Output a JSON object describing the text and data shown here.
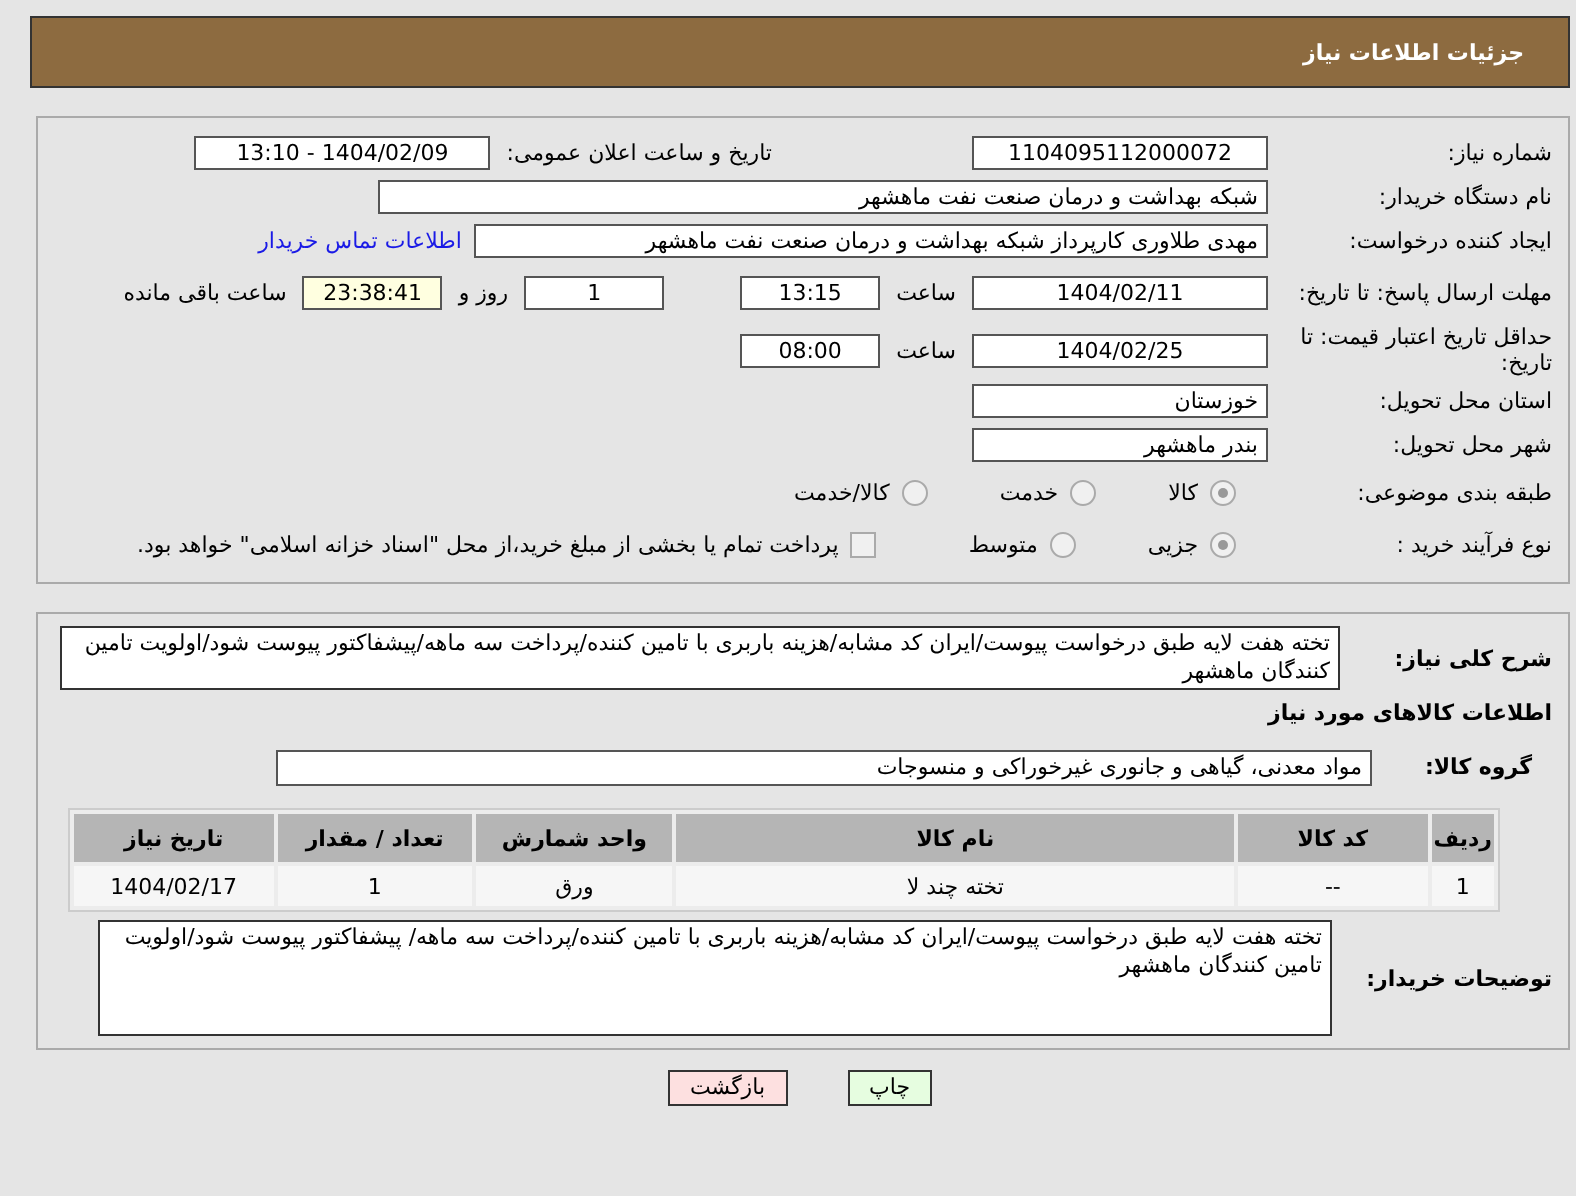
{
  "header": {
    "title": "جزئیات اطلاعات نیاز"
  },
  "need_number": {
    "label": "شماره نیاز:",
    "value": "1104095112000072"
  },
  "announce_datetime": {
    "label": "تاریخ و ساعت اعلان عمومی:",
    "value": "1404/02/09 - 13:10"
  },
  "buyer_org": {
    "label": "نام دستگاه خریدار:",
    "value": "شبکه بهداشت و درمان صنعت نفت ماهشهر"
  },
  "requester": {
    "label": "ایجاد کننده درخواست:",
    "value": "مهدی طلاوری کارپرداز شبکه بهداشت و درمان صنعت نفت ماهشهر",
    "link": "اطلاعات تماس خریدار"
  },
  "response_deadline": {
    "label": "مهلت ارسال پاسخ: تا تاریخ:",
    "date": "1404/02/11",
    "time_label": "ساعت",
    "time": "13:15",
    "days": "1",
    "days_label": "روز و",
    "remaining": "23:38:41",
    "remaining_label": "ساعت باقی مانده"
  },
  "price_validity": {
    "label": "حداقل تاریخ اعتبار قیمت: تا تاریخ:",
    "date": "1404/02/25",
    "time_label": "ساعت",
    "time": "08:00"
  },
  "delivery_province": {
    "label": "استان محل تحویل:",
    "value": "خوزستان"
  },
  "delivery_city": {
    "label": "شهر محل تحویل:",
    "value": "بندر ماهشهر"
  },
  "category": {
    "label": "طبقه بندی موضوعی:",
    "options": [
      {
        "label": "کالا",
        "selected": true
      },
      {
        "label": "خدمت",
        "selected": false
      },
      {
        "label": "کالا/خدمت",
        "selected": false
      }
    ]
  },
  "purchase_process": {
    "label": "نوع فرآیند خرید :",
    "options": [
      {
        "label": "جزیی",
        "selected": true
      },
      {
        "label": "متوسط",
        "selected": false
      }
    ],
    "payment": {
      "checked": false,
      "label": "پرداخت تمام یا بخشی از مبلغ خرید،از محل \"اسناد خزانه اسلامی\" خواهد بود."
    }
  },
  "description": {
    "label": "شرح کلی نیاز:",
    "value": "تخته هفت لایه طبق درخواست پیوست/ایران کد مشابه/هزینه باربری با تامین کننده/پرداخت سه ماهه/پیشفاکتور پیوست شود/اولویت تامین کنندگان ماهشهر"
  },
  "goods_heading": "اطلاعات کالاهای مورد نیاز",
  "goods_group": {
    "label": "گروه کالا:",
    "value": "مواد معدنی، گیاهی و جانوری غیرخوراکی و منسوجات"
  },
  "table": {
    "columns": [
      "ردیف",
      "کد کالا",
      "نام کالا",
      "واحد شمارش",
      "تعداد / مقدار",
      "تاریخ نیاز"
    ],
    "rows": [
      [
        "1",
        "--",
        "تخته چند لا",
        "ورق",
        "1",
        "1404/02/17"
      ]
    ]
  },
  "buyer_notes": {
    "label": "توضیحات خریدار:",
    "value": "تخته هفت لایه طبق درخواست پیوست/ایران کد مشابه/هزینه باربری با تامین کننده/پرداخت سه ماهه/ پیشفاکتور پیوست شود/اولویت تامین کنندگان ماهشهر"
  },
  "buttons": [
    {
      "label": "چاپ",
      "kind": "print"
    },
    {
      "label": "بازگشت",
      "kind": "back"
    }
  ]
}
